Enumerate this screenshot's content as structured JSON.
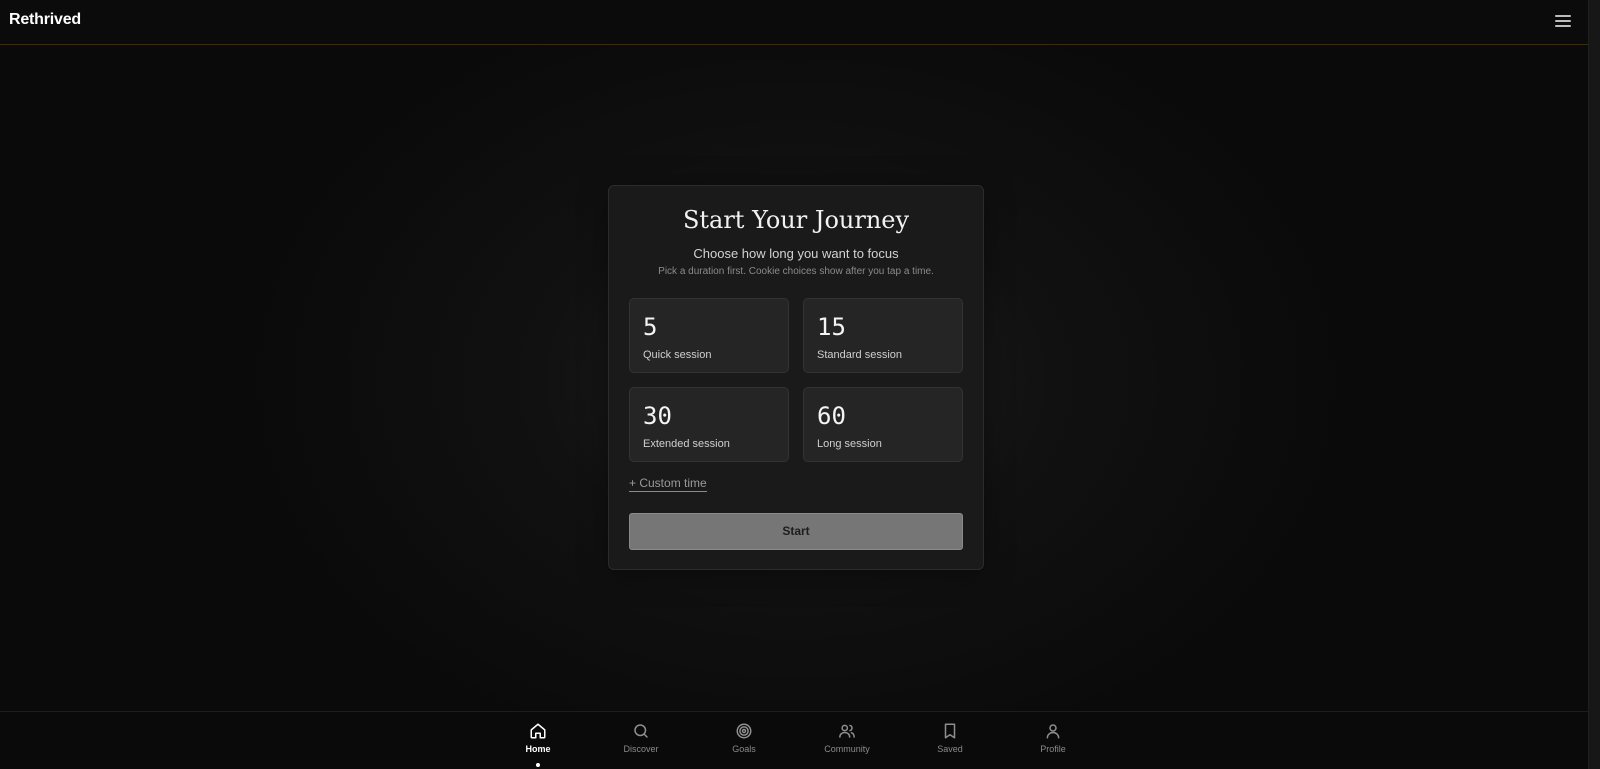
{
  "header": {
    "brand": "Rethrived",
    "menu_icon": "hamburger-menu-icon"
  },
  "card": {
    "title": "Start Your Journey",
    "subtitle": "Choose how long you want to focus",
    "note": "Pick a duration first. Cookie choices show after you tap a time.",
    "options": [
      {
        "minutes": "5",
        "label": "Quick session"
      },
      {
        "minutes": "15",
        "label": "Standard session"
      },
      {
        "minutes": "30",
        "label": "Extended session"
      },
      {
        "minutes": "60",
        "label": "Long session"
      }
    ],
    "custom_link": "+ Custom time",
    "start_label": "Start"
  },
  "nav": {
    "items": [
      {
        "label": "Home",
        "icon": "home-icon",
        "active": true
      },
      {
        "label": "Discover",
        "icon": "search-icon",
        "active": false
      },
      {
        "label": "Goals",
        "icon": "target-icon",
        "active": false
      },
      {
        "label": "Community",
        "icon": "users-icon",
        "active": false
      },
      {
        "label": "Saved",
        "icon": "bookmark-icon",
        "active": false
      },
      {
        "label": "Profile",
        "icon": "user-icon",
        "active": false
      }
    ]
  },
  "colors": {
    "background": "#0a0a0a",
    "card": "#1a1a1a",
    "option": "#252525",
    "start_button": "#767676",
    "header_border": "#3a2c10"
  }
}
